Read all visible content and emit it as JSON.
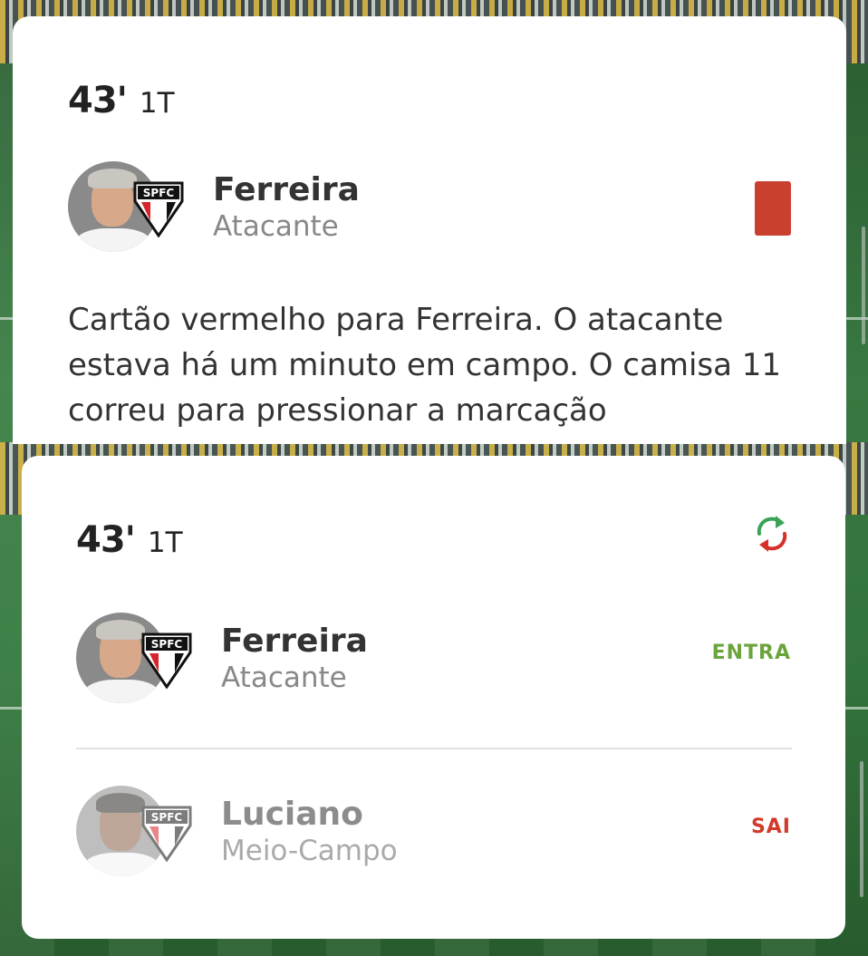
{
  "event_card": {
    "minute": "43'",
    "half": "1T",
    "player": {
      "name": "Ferreira",
      "position": "Atacante",
      "team": "SPFC"
    },
    "card_color": "#c9402f",
    "description": "Cartão vermelho para Ferreira. O atacante estava há um minuto em campo. O camisa 11 correu para pressionar a marcação"
  },
  "substitution_card": {
    "minute": "43'",
    "half": "1T",
    "player_in": {
      "name": "Ferreira",
      "position": "Atacante",
      "team": "SPFC",
      "tag": "ENTRA",
      "tag_color": "#6aa43a"
    },
    "player_out": {
      "name": "Luciano",
      "position": "Meio-Campo",
      "team": "SPFC",
      "tag": "SAI",
      "tag_color": "#d23a2a"
    }
  },
  "icons": [
    "spfc-crest-icon",
    "red-card-icon",
    "substitution-icon"
  ]
}
